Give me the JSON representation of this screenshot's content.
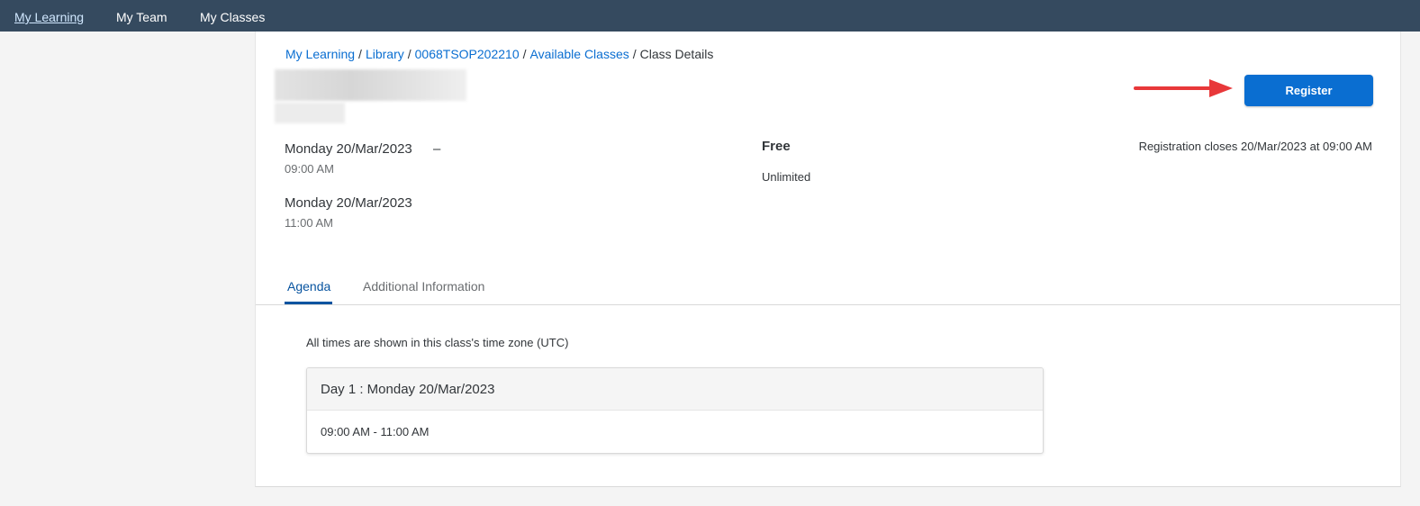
{
  "nav": {
    "items": [
      {
        "label": "My Learning",
        "active": true
      },
      {
        "label": "My Team",
        "active": false
      },
      {
        "label": "My Classes",
        "active": false
      }
    ]
  },
  "breadcrumb": {
    "items": [
      "My Learning",
      "Library",
      "0068TSOP202210",
      "Available Classes"
    ],
    "current": "Class Details",
    "separator": "/"
  },
  "register_label": "Register",
  "schedule": {
    "start_date": "Monday 20/Mar/2023",
    "start_time": "09:00 AM",
    "dash": "–",
    "end_date": "Monday 20/Mar/2023",
    "end_time": "11:00 AM"
  },
  "price": "Free",
  "seats": "Unlimited",
  "registration_closes": "Registration closes 20/Mar/2023 at 09:00 AM",
  "tabs": [
    {
      "label": "Agenda",
      "active": true
    },
    {
      "label": "Additional Information",
      "active": false
    }
  ],
  "agenda": {
    "timezone_note": "All times are shown in this class's time zone (UTC)",
    "day_title": "Day 1 : Monday 20/Mar/2023",
    "time_range": "09:00 AM - 11:00 AM"
  },
  "colors": {
    "nav_bg": "#354a5f",
    "link": "#0a6ed1",
    "button": "#0a6ed1",
    "tab_active": "#0854a0",
    "annotation_arrow": "#e8383a"
  }
}
